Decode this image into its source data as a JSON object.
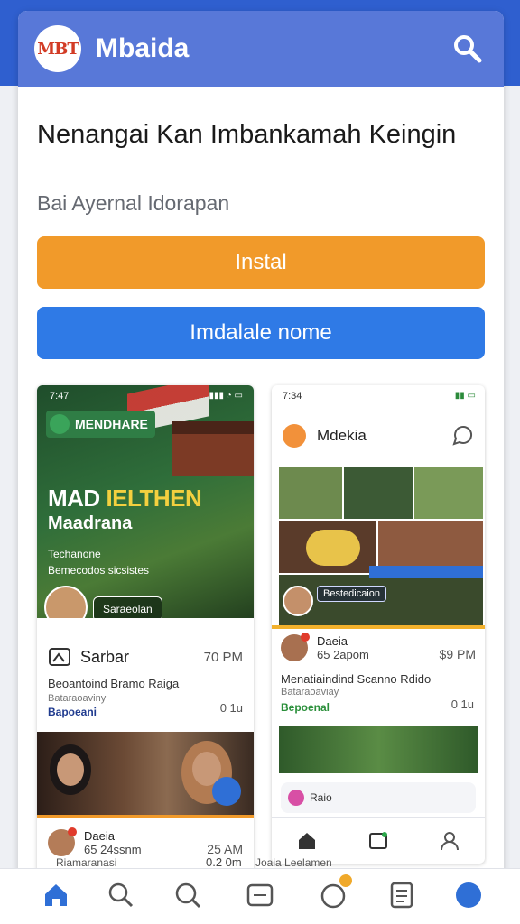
{
  "header": {
    "logo_text": "MBT",
    "app_name": "Mbaida",
    "search_icon": "search-icon"
  },
  "hero_text": {
    "headline": "Nenangai Kan Imbankamah Keingin",
    "subline": "Bai Ayernal Idorapan"
  },
  "buttons": {
    "install": "Instal",
    "secondary": "Imdalale nome"
  },
  "left_card": {
    "status_time": "7:47",
    "badge": "MENDHARE",
    "title_white": "MAD ",
    "title_yellow": "IELTHEN",
    "subtitle": "Maadrana",
    "desc_line1": "Techanone",
    "desc_line2": "Bemecodos sicsistes",
    "pill": "Saraeolan",
    "row_label": "Sarbar",
    "row_time": "70 PM",
    "meta_title": "Beoantoind Bramo Raiga",
    "meta_sub": "Bataraoaviny",
    "meta_tag": "Bapoeani",
    "meta_right": "0 1u",
    "post_name": "Daeia",
    "post_date": "65 24ssnm",
    "post_time": "25 AM",
    "post_peek": "Riamaranasi",
    "post_peek_right": "0.2 0m"
  },
  "right_card": {
    "status_time": "7:34",
    "app_name": "Mdekia",
    "overlay_pill": "Bestedicaion",
    "post_name": "Daeia",
    "post_date": "65 2apom",
    "post_time": "$9 PM",
    "meta_title": "Menatiaindind Scanno Rdido",
    "meta_sub": "Bataraoaviay",
    "meta_tag": "Bepoenal",
    "meta_right": "0 1u",
    "mini_label": "Raio",
    "peek": "Joaia Leelamen"
  },
  "bottom_nav": {
    "items": [
      "home-icon",
      "search-icon",
      "chat-search-icon",
      "message-icon",
      "notifications-icon",
      "list-icon",
      "profile-icon"
    ]
  },
  "colors": {
    "header": "#5878d8",
    "install": "#f19a2a",
    "secondary": "#2f7ae6",
    "nav_active": "#2f6fd6"
  }
}
